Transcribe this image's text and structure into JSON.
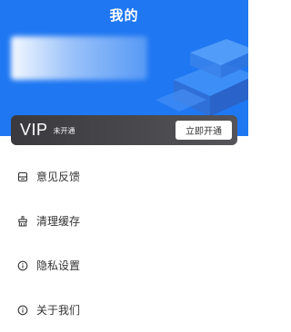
{
  "header": {
    "title": "我的",
    "background_color": "#1f77f2"
  },
  "vip": {
    "title": "VIP",
    "status": "未开通",
    "button_label": "立即开通"
  },
  "menu": {
    "items": [
      {
        "label": "意见反馈",
        "icon": "feedback-icon"
      },
      {
        "label": "清理缓存",
        "icon": "clean-cache-icon"
      },
      {
        "label": "隐私设置",
        "icon": "info-icon"
      },
      {
        "label": "关于我们",
        "icon": "info-icon"
      }
    ]
  }
}
